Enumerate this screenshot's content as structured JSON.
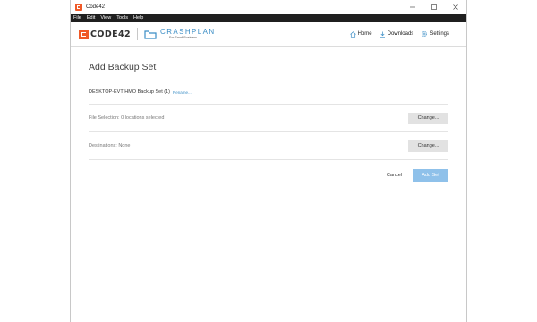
{
  "window": {
    "title": "Code42",
    "controls": [
      "minimize",
      "maximize",
      "close"
    ]
  },
  "menu": {
    "items": [
      "File",
      "Edit",
      "View",
      "Tools",
      "Help"
    ]
  },
  "header": {
    "brand": "CODE42",
    "product": "CRASHPLAN",
    "product_sub": "For Small Business",
    "nav": [
      {
        "label": "Home",
        "icon": "home-icon"
      },
      {
        "label": "Downloads",
        "icon": "download-icon"
      },
      {
        "label": "Settings",
        "icon": "gear-icon"
      }
    ]
  },
  "page": {
    "title": "Add Backup Set",
    "set_name": "DESKTOP-EVTIHMO Backup Set (1)",
    "rename_label": "Rename...",
    "file_selection": "File Selection: 0 locations selected",
    "destinations": "Destinations: None",
    "change_label": "Change...",
    "cancel_label": "Cancel",
    "add_set_label": "Add Set"
  },
  "colors": {
    "brand_orange": "#f05a28",
    "crashplan_blue": "#3a8dc5",
    "primary_disabled": "#8fc1ea",
    "menubar": "#1f1f1f"
  }
}
